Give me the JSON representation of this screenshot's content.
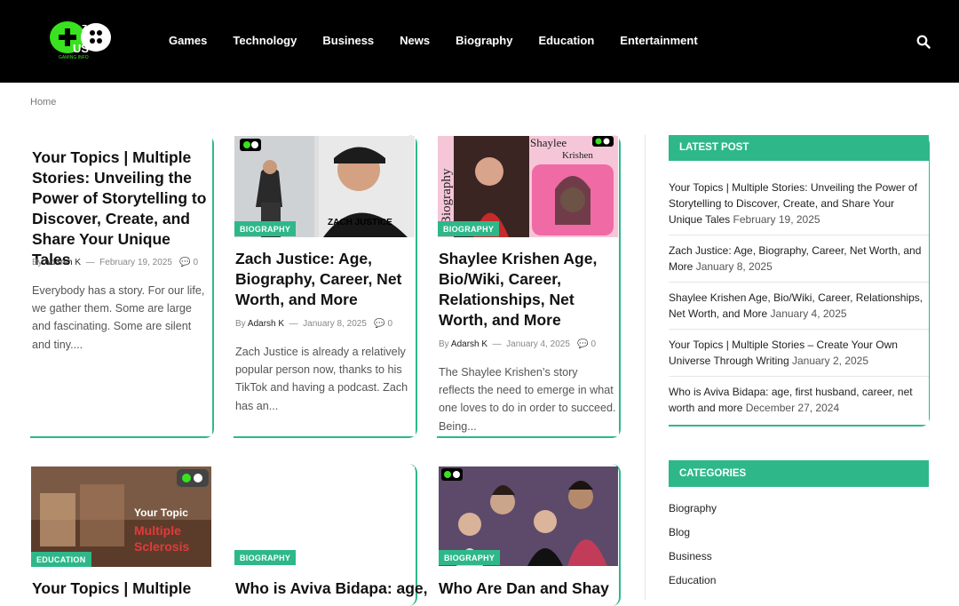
{
  "header": {
    "logo_text": "US",
    "logo_sub": "GAMING INFO",
    "nav": [
      "Games",
      "Technology",
      "Business",
      "News",
      "Biography",
      "Education",
      "Entertainment"
    ]
  },
  "breadcrumb": "Home",
  "posts": [
    {
      "title": "Your Topics | Multiple Stories: Unveiling the Power of Storytelling to Discover, Create, and Share Your Unique Tales",
      "author": "Adarsh K",
      "date": "February 19, 2025",
      "comments": "0",
      "excerpt": "Everybody has a story. For our life, we gather them. Some are large and fascinating. Some are silent and tiny...."
    },
    {
      "badge": "BIOGRAPHY",
      "thumb_caption": "ZACH JUSTICE",
      "title": "Zach Justice: Age, Biography, Career, Net Worth, and More",
      "author": "Adarsh K",
      "date": "January 8, 2025",
      "comments": "0",
      "excerpt": "Zach Justice is already a relatively popular person now, thanks to his TikTok and having a podcast. Zach has an..."
    },
    {
      "badge": "BIOGRAPHY",
      "thumb_side": "Biography",
      "thumb_name1": "Shaylee",
      "thumb_name2": "Krishen",
      "title": "Shaylee Krishen Age, Bio/Wiki, Career, Relationships, Net Worth, and More",
      "author": "Adarsh K",
      "date": "January 4, 2025",
      "comments": "0",
      "excerpt": "The Shaylee Krishen’s story reflects the need to emerge in what one loves to do in order to succeed. Being..."
    },
    {
      "badge": "EDUCATION",
      "thumb_line1": "Your Topic",
      "thumb_line2": "Multiple",
      "thumb_line3": "Sclerosis",
      "title": "Your Topics | Multiple"
    },
    {
      "badge": "BIOGRAPHY",
      "title": "Who is Aviva Bidapa: age,"
    },
    {
      "badge": "BIOGRAPHY",
      "title": "Who Are Dan and Shay"
    }
  ],
  "meta_by": "By",
  "latest": {
    "heading": "LATEST POST",
    "items": [
      {
        "text": "Your Topics | Multiple Stories: Unveiling the Power of Storytelling to Discover, Create, and Share Your Unique Tales",
        "date": "February 19, 2025"
      },
      {
        "text": "Zach Justice: Age, Biography, Career, Net Worth, and More",
        "date": "January 8, 2025"
      },
      {
        "text": "Shaylee Krishen Age, Bio/Wiki, Career, Relationships, Net Worth, and More",
        "date": "January 4, 2025"
      },
      {
        "text": "Your Topics | Multiple Stories – Create Your Own Universe Through Writing",
        "date": "January 2, 2025"
      },
      {
        "text": "Who is Aviva Bidapa: age, first husband, career, net worth and more",
        "date": "December 27, 2024"
      }
    ]
  },
  "categories": {
    "heading": "CATEGORIES",
    "items": [
      "Biography",
      "Blog",
      "Business",
      "Education"
    ]
  },
  "colors": {
    "accent": "#2eb88a",
    "header_bg": "#000000"
  }
}
